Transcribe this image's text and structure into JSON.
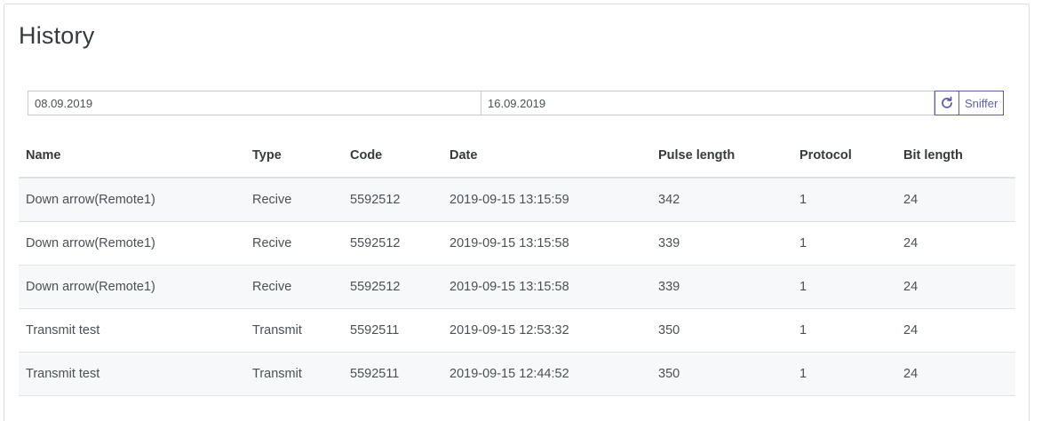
{
  "page": {
    "title": "History"
  },
  "filters": {
    "date_from": "08.09.2019",
    "date_to": "16.09.2019",
    "refresh_icon": "refresh-icon",
    "sniffer_label": "Sniffer"
  },
  "table": {
    "headers": {
      "name": "Name",
      "type": "Type",
      "code": "Code",
      "date": "Date",
      "pulse": "Pulse length",
      "protocol": "Protocol",
      "bits": "Bit length"
    },
    "rows": [
      {
        "name": "Down arrow(Remote1)",
        "type": "Recive",
        "code": "5592512",
        "date": "2019-09-15 13:15:59",
        "pulse": "342",
        "protocol": "1",
        "bits": "24"
      },
      {
        "name": "Down arrow(Remote1)",
        "type": "Recive",
        "code": "5592512",
        "date": "2019-09-15 13:15:58",
        "pulse": "339",
        "protocol": "1",
        "bits": "24"
      },
      {
        "name": "Down arrow(Remote1)",
        "type": "Recive",
        "code": "5592512",
        "date": "2019-09-15 13:15:58",
        "pulse": "339",
        "protocol": "1",
        "bits": "24"
      },
      {
        "name": "Transmit test",
        "type": "Transmit",
        "code": "5592511",
        "date": "2019-09-15 12:53:32",
        "pulse": "350",
        "protocol": "1",
        "bits": "24"
      },
      {
        "name": "Transmit test",
        "type": "Transmit",
        "code": "5592511",
        "date": "2019-09-15 12:44:52",
        "pulse": "350",
        "protocol": "1",
        "bits": "24"
      }
    ]
  },
  "colors": {
    "accent": "#5a5fa8",
    "stripe": "#f7f8f9"
  }
}
